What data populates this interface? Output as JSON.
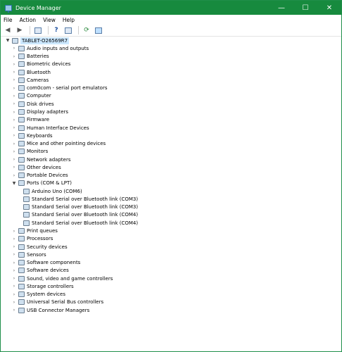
{
  "window": {
    "title": "Device Manager",
    "minimize": "—",
    "maximize": "☐",
    "close": "✕"
  },
  "menu": [
    "File",
    "Action",
    "View",
    "Help"
  ],
  "toolbar_icons": [
    "back-arrow-icon",
    "forward-arrow-icon",
    "properties-icon",
    "help-icon",
    "view-icon",
    "scan-icon",
    "monitor-icon"
  ],
  "tree": {
    "root": "TABLET-O26569R7",
    "categories_before": [
      "Audio inputs and outputs",
      "Batteries",
      "Biometric devices",
      "Bluetooth",
      "Cameras",
      "com0com - serial port emulators",
      "Computer",
      "Disk drives",
      "Display adapters",
      "Firmware",
      "Human Interface Devices",
      "Keyboards",
      "Mice and other pointing devices",
      "Monitors",
      "Network adapters",
      "Other devices",
      "Portable Devices"
    ],
    "expanded_category": "Ports (COM & LPT)",
    "ports": [
      "Arduino Uno (COM6)",
      "Standard Serial over Bluetooth link (COM3)",
      "Standard Serial over Bluetooth link (COM3)",
      "Standard Serial over Bluetooth link (COM4)",
      "Standard Serial over Bluetooth link (COM4)"
    ],
    "categories_after": [
      "Print queues",
      "Processors",
      "Security devices",
      "Sensors",
      "Software components",
      "Software devices",
      "Sound, video and game controllers",
      "Storage controllers",
      "System devices",
      "Universal Serial Bus controllers",
      "USB Connector Managers"
    ]
  }
}
